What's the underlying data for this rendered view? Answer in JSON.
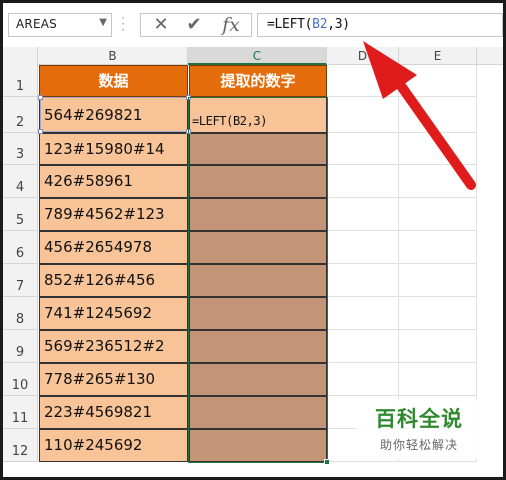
{
  "formula_bar": {
    "name_box": "AREAS",
    "cancel_icon": "cancel-x-icon",
    "enter_icon": "checkmark-icon",
    "fx_label": "fx",
    "formula_prefix": "=LEFT(",
    "formula_ref": "B2",
    "formula_suffix": ",3)"
  },
  "columns": [
    "B",
    "C",
    "D",
    "E"
  ],
  "rows": [
    "1",
    "2",
    "3",
    "4",
    "5",
    "6",
    "7",
    "8",
    "9",
    "10",
    "11",
    "12"
  ],
  "table": {
    "header_b": "数据",
    "header_c": "提取的数字",
    "values": [
      "564#269821",
      "123#15980#14",
      "426#58961",
      "789#4562#123",
      "456#2654978",
      "852#126#456",
      "741#1245692",
      "569#236512#2",
      "778#265#130",
      "223#4569821",
      "110#245692"
    ],
    "editing_formula": "=LEFT(B2,3)"
  },
  "colors": {
    "header_fill": "#e46c0a",
    "data_fill": "#f8c497",
    "empty_fill": "#c49476",
    "arrow": "#e01b1b",
    "watermark_green": "#2f8a2f"
  },
  "watermark": {
    "title": "百科全说",
    "subtitle": "助你轻松解决"
  }
}
